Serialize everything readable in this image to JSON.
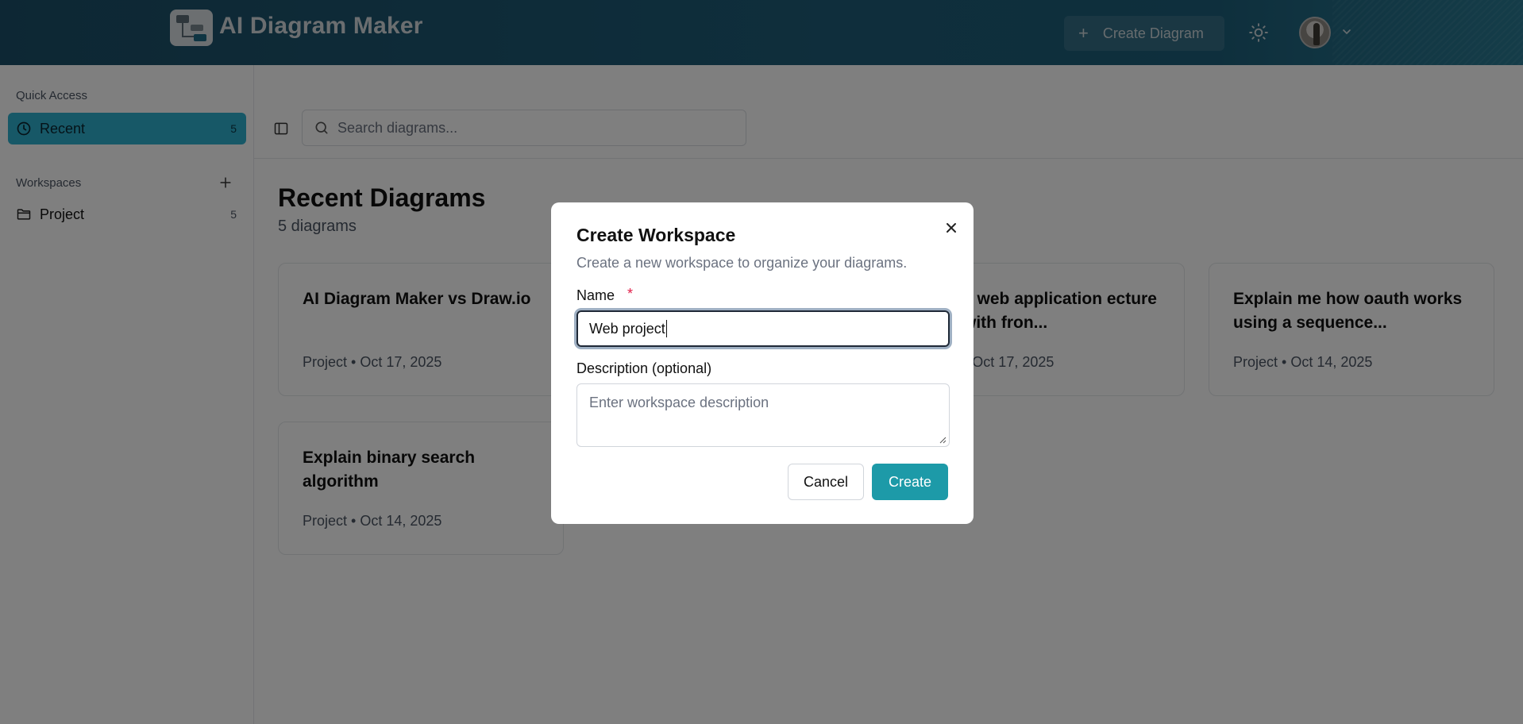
{
  "header": {
    "app_title": "AI Diagram Maker",
    "create_diagram_label": "Create Diagram",
    "create_diagram_icon": "plus-icon",
    "theme_icon": "sun-icon",
    "avatar_icon": "user-avatar",
    "menu_icon": "chevron-down-icon"
  },
  "sidebar": {
    "quick_access_label": "Quick Access",
    "recent": {
      "label": "Recent",
      "count": "5",
      "icon": "clock-icon"
    },
    "workspaces_label": "Workspaces",
    "add_icon": "plus-icon",
    "workspaces": [
      {
        "label": "Project",
        "count": "5",
        "icon": "folder-icon"
      }
    ]
  },
  "toolbar": {
    "sidebar_toggle_icon": "sidebar-toggle-icon",
    "search_icon": "search-icon",
    "search_placeholder": "Search diagrams..."
  },
  "main": {
    "title": "Recent Diagrams",
    "subtitle": "5 diagrams",
    "cards": [
      {
        "title": "AI Diagram Maker vs Draw.io",
        "meta": "Project • Oct 17, 2025"
      },
      {
        "title": "a web application ecture with fron...",
        "meta": "• Oct 17, 2025"
      },
      {
        "title": "Explain me how oauth works using a sequence...",
        "meta": "Project • Oct 14, 2025"
      },
      {
        "title": "Explain binary search algorithm",
        "meta": "Project • Oct 14, 2025"
      }
    ]
  },
  "modal": {
    "title": "Create Workspace",
    "description": "Create a new workspace to organize your diagrams.",
    "name_label": "Name",
    "required_marker": "*",
    "name_value": "Web project",
    "description_label": "Description (optional)",
    "description_placeholder": "Enter workspace description",
    "cancel_label": "Cancel",
    "create_label": "Create",
    "close_icon": "close-icon"
  },
  "colors": {
    "header_bg": "#1e5d78",
    "accent": "#2eb1cf",
    "primary_button": "#1d9aa8",
    "required": "#e11d48"
  }
}
